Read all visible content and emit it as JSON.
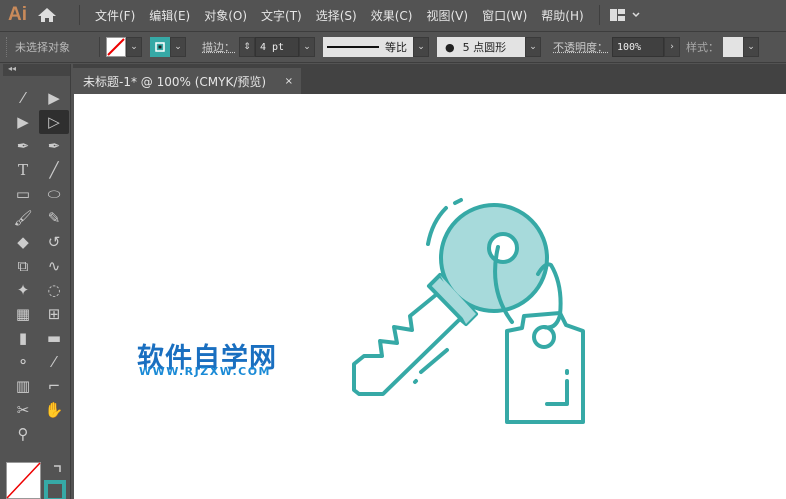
{
  "app": {
    "logo": "Ai"
  },
  "menu": [
    "文件(F)",
    "编辑(E)",
    "对象(O)",
    "文字(T)",
    "选择(S)",
    "效果(C)",
    "视图(V)",
    "窗口(W)",
    "帮助(H)"
  ],
  "control": {
    "selection": "未选择对象",
    "stroke_label": "描边：",
    "stroke_value": "4 pt",
    "line_profile": "等比",
    "brush": "5 点圆形",
    "opacity_label": "不透明度：",
    "opacity_value": "100%",
    "style_label": "样式："
  },
  "document": {
    "tab": "未标题-1* @ 100% (CMYK/预览)",
    "close": "×"
  },
  "watermark": {
    "title": "软件自学网",
    "url": "WWW.RJZXW.COM"
  },
  "colors": {
    "teal": "#36a9a6",
    "teal_light": "#a7dadb",
    "brand": "#1a6fc0"
  }
}
